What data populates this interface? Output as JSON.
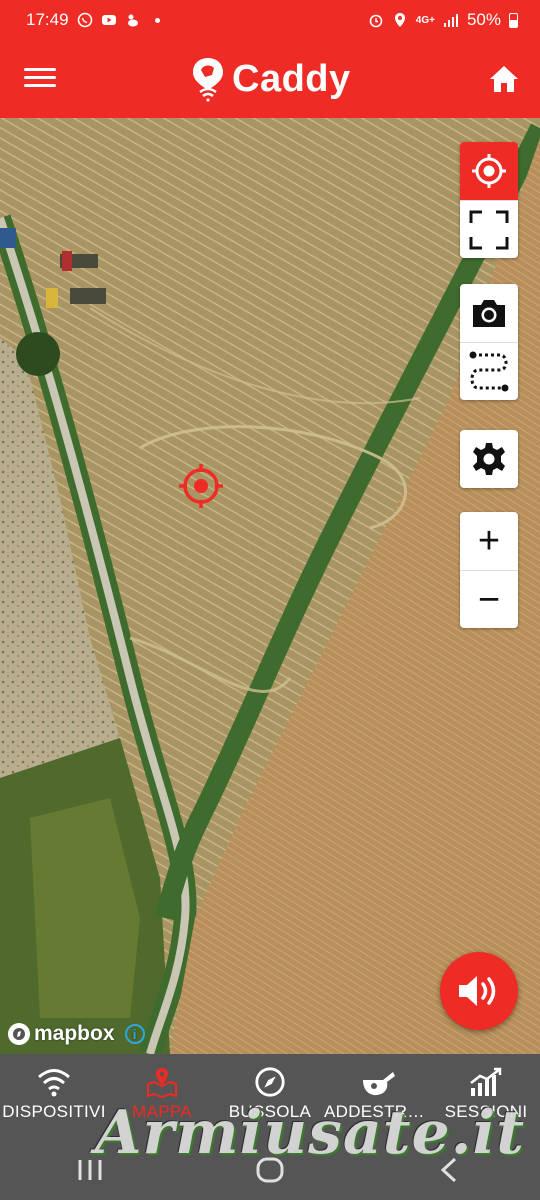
{
  "statusbar": {
    "time": "17:49",
    "network": "4G+",
    "battery": "50%"
  },
  "appbar": {
    "title": "Caddy"
  },
  "map": {
    "attribution": "mapbox",
    "info_label": "i"
  },
  "controls": {
    "zoom_in": "+",
    "zoom_out": "−"
  },
  "bottomnav": {
    "items": [
      {
        "label": "DISPOSITIVI",
        "icon": "wifi-icon"
      },
      {
        "label": "MAPPA",
        "icon": "map-pin-icon"
      },
      {
        "label": "BUSSOLA",
        "icon": "compass-icon"
      },
      {
        "label": "ADDESTRAMENTO",
        "icon": "whistle-icon"
      },
      {
        "label": "SESSIONI",
        "icon": "chart-icon"
      }
    ],
    "active": "MAPPA"
  },
  "watermark": "Armiusate.it",
  "colors": {
    "brand": "#ee2b24",
    "nav_bg": "#555555",
    "active": "#ee2b24"
  }
}
